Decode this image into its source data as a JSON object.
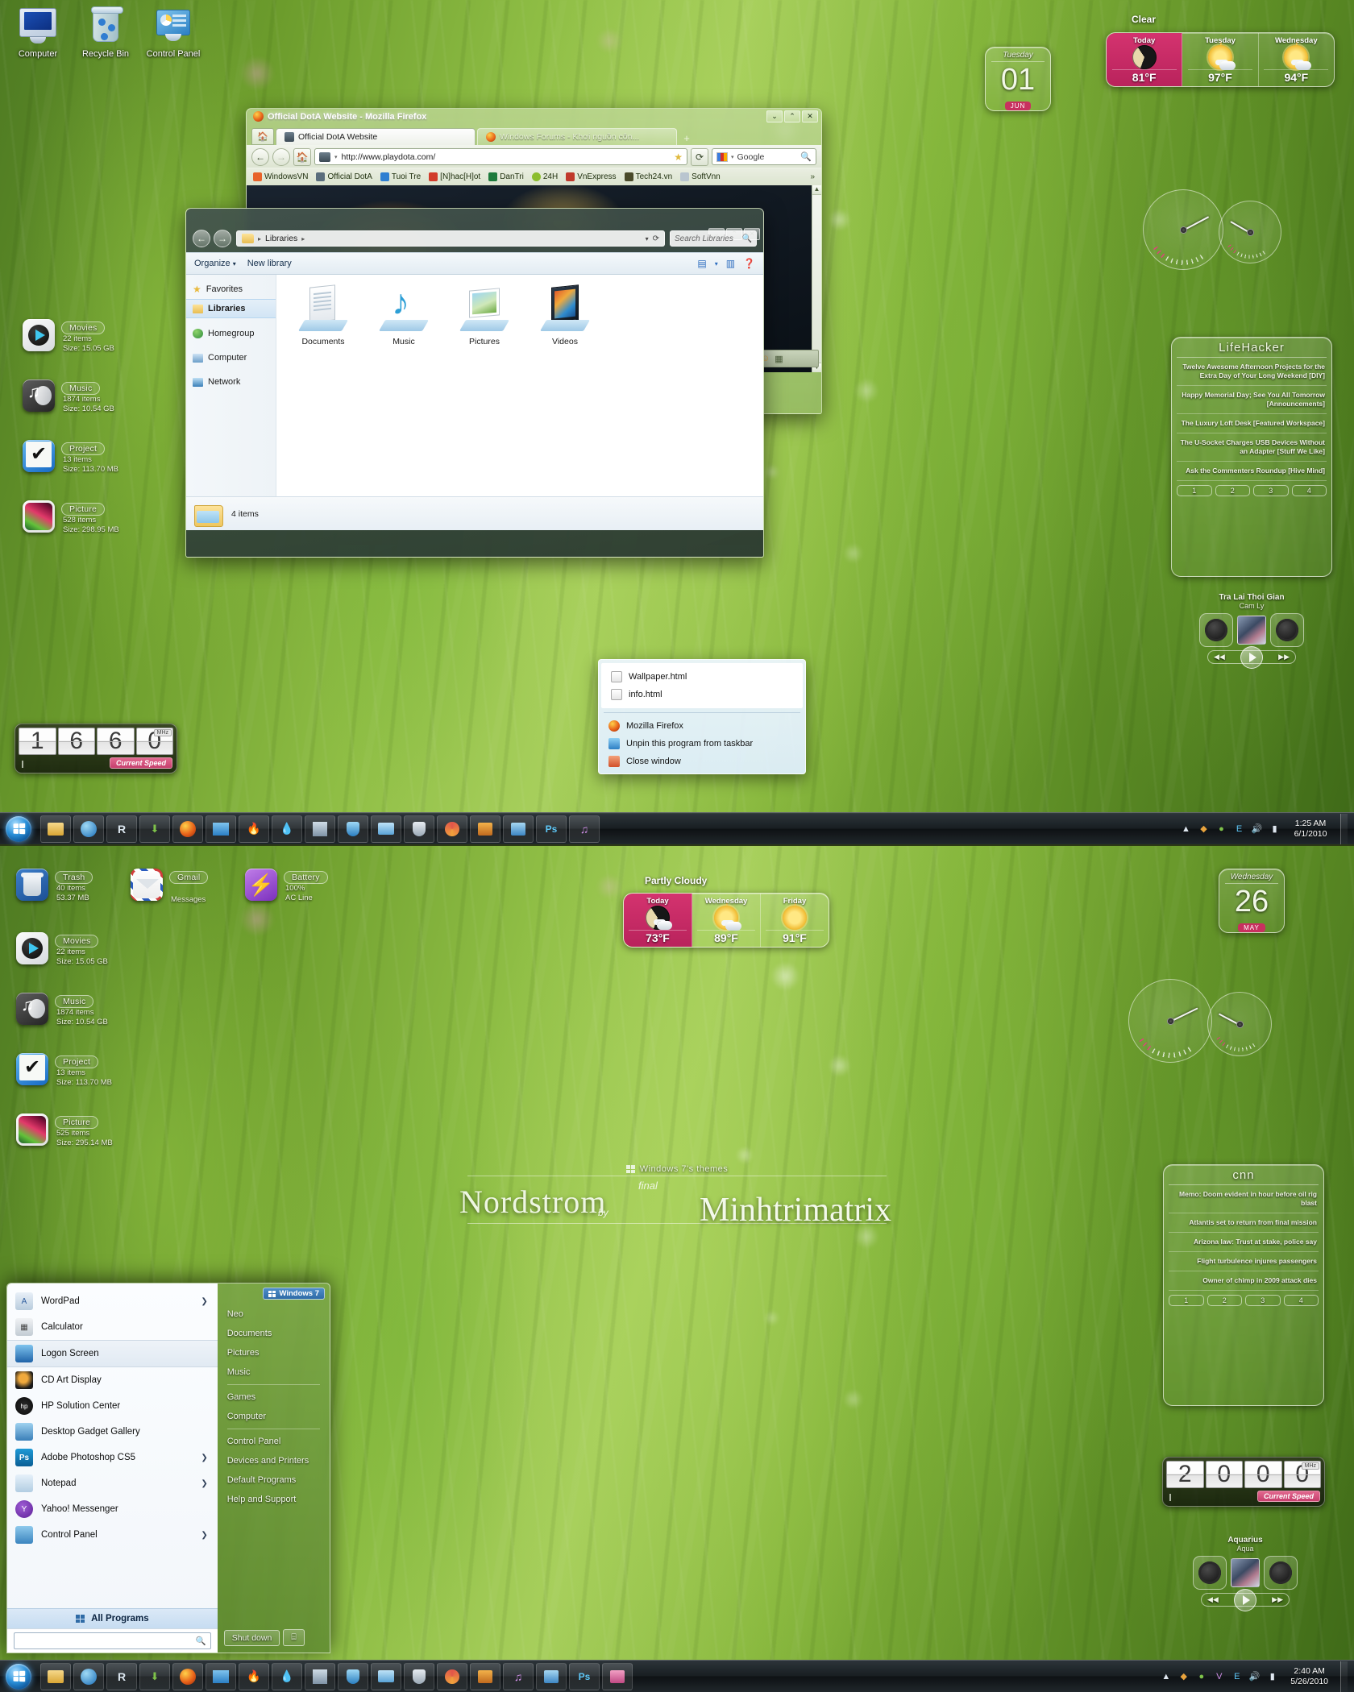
{
  "desktop_icons": [
    {
      "label": "Computer",
      "icon": "computer-icon"
    },
    {
      "label": "Recycle Bin",
      "icon": "recycle-bin-icon"
    },
    {
      "label": "Control Panel",
      "icon": "control-panel-icon"
    }
  ],
  "file_gadgets_top": [
    {
      "name": "Movies",
      "count": "22 items",
      "size": "Size: 15.05 GB",
      "icon": "movies-icon"
    },
    {
      "name": "Music",
      "count": "1874 items",
      "size": "Size: 10.54 GB",
      "icon": "music-icon"
    },
    {
      "name": "Project",
      "count": "13 items",
      "size": "Size: 113.70 MB",
      "icon": "project-icon"
    },
    {
      "name": "Picture",
      "count": "528 items",
      "size": "Size: 298.95 MB",
      "icon": "picture-icon"
    }
  ],
  "file_gadgets_bottom_row1": [
    {
      "name": "Trash",
      "count": "40 items",
      "size": "53.37 MB",
      "icon": "trash-icon"
    },
    {
      "name": "Gmail",
      "count": "",
      "size": "Messages",
      "icon": "gmail-icon"
    },
    {
      "name": "Battery",
      "count": "100%",
      "size": "AC Line",
      "icon": "battery-icon"
    }
  ],
  "file_gadgets_bottom": [
    {
      "name": "Movies",
      "count": "22 items",
      "size": "Size: 15.05 GB",
      "icon": "movies-icon"
    },
    {
      "name": "Music",
      "count": "1874 items",
      "size": "Size: 10.54 GB",
      "icon": "music-icon"
    },
    {
      "name": "Project",
      "count": "13 items",
      "size": "Size: 113.70 MB",
      "icon": "project-icon"
    },
    {
      "name": "Picture",
      "count": "525 items",
      "size": "Size: 295.14 MB",
      "icon": "picture-icon"
    }
  ],
  "calendar_top": {
    "weekday": "Tuesday",
    "day": "01",
    "month": "JUN"
  },
  "calendar_bottom": {
    "weekday": "Wednesday",
    "day": "26",
    "month": "MAY"
  },
  "weather_top": {
    "condition": "Clear",
    "days": [
      {
        "label": "Today",
        "temp": "81°F",
        "icon": "moon-icon"
      },
      {
        "label": "Tuesday",
        "temp": "97°F",
        "icon": "sun-cloud-icon"
      },
      {
        "label": "Wednesday",
        "temp": "94°F",
        "icon": "sun-cloud-icon"
      }
    ]
  },
  "weather_bottom": {
    "condition": "Partly Cloudy",
    "days": [
      {
        "label": "Today",
        "temp": "73°F",
        "icon": "moon-cloud-icon"
      },
      {
        "label": "Wednesday",
        "temp": "89°F",
        "icon": "sun-cloud-icon"
      },
      {
        "label": "Friday",
        "temp": "91°F",
        "icon": "sun-icon"
      }
    ]
  },
  "feed_lifehacker": {
    "title": "LifeHacker",
    "items": [
      "Twelve Awesome Afternoon Projects for the Extra Day of Your Long Weekend [DIY]",
      "Happy Memorial Day; See You All Tomorrow [Announcements]",
      "The Luxury Loft Desk [Featured Workspace]",
      "The U-Socket Charges USB Devices Without an Adapter [Stuff We Like]",
      "Ask the Commenters Roundup [Hive Mind]"
    ],
    "pages": [
      "1",
      "2",
      "3",
      "4"
    ]
  },
  "feed_cnn": {
    "title": "cnn",
    "items": [
      "Memo: Doom evident in hour before oil rig blast",
      "Atlantis set to return from final mission",
      "Arizona law: Trust at stake, police say",
      "Flight turbulence injures passengers",
      "Owner of chimp in 2009 attack dies"
    ],
    "pages": [
      "1",
      "2",
      "3",
      "4"
    ]
  },
  "player_top": {
    "title": "Tra Lai Thoi Gian",
    "artist": "Cam Ly",
    "prev": "◀◀",
    "next": "▶▶",
    "play": "play-icon"
  },
  "player_bottom": {
    "title": "Aquarius",
    "artist": "Aqua",
    "prev": "◀◀",
    "next": "▶▶",
    "play": "play-icon"
  },
  "cpu_top": {
    "digits": [
      "1",
      "6",
      "6",
      "0"
    ],
    "unit": "MHz",
    "label": "Current Speed"
  },
  "cpu_bottom": {
    "digits": [
      "2",
      "0",
      "0",
      "0"
    ],
    "unit": "MHz",
    "label": "Current Speed"
  },
  "firefox": {
    "window_title": "Official DotA Website - Mozilla Firefox",
    "tabs": [
      {
        "label": "Official DotA Website",
        "active": true
      },
      {
        "label": "Windows Forums - Khơi nguồn côn...",
        "active": false
      }
    ],
    "new_tab": "+",
    "url": "http://www.playdota.com/",
    "search_engine": "Google",
    "search_placeholder": "Google",
    "bookmarks": [
      {
        "label": "WindowsVN",
        "color": "#e8632a"
      },
      {
        "label": "Official DotA",
        "color": "#5a6d7c"
      },
      {
        "label": "Tuoi Tre",
        "color": "#2e7fd1"
      },
      {
        "label": "[N]hac[H]ot",
        "color": "#d23b2a"
      },
      {
        "label": "DanTri",
        "color": "#1d7a3c"
      },
      {
        "label": "24H",
        "color": "#8bbd2e"
      },
      {
        "label": "VnExpress",
        "color": "#c0392b"
      },
      {
        "label": "Tech24.vn",
        "color": "#4a4a2a"
      },
      {
        "label": "SoftVnn",
        "color": "#b9c5cf"
      }
    ],
    "bookmarks_overflow": "»",
    "window_buttons": {
      "minimize": "⌄",
      "maximize": "⌃",
      "close": "✕"
    }
  },
  "explorer": {
    "breadcrumb": "Libraries",
    "search_placeholder": "Search Libraries",
    "toolbar": [
      "Organize",
      "New library"
    ],
    "nav_items": [
      "Favorites",
      "Libraries",
      "Homegroup",
      "Computer",
      "Network"
    ],
    "nav_selected": "Libraries",
    "libraries": [
      {
        "label": "Documents"
      },
      {
        "label": "Music"
      },
      {
        "label": "Pictures"
      },
      {
        "label": "Videos"
      }
    ],
    "status": "4 items",
    "window_buttons": {
      "minimize": "⌄",
      "maximize": "⌃",
      "close": "✕"
    }
  },
  "jumplist": {
    "recent": [
      {
        "label": "Wallpaper.html",
        "icon": "html-file-icon"
      },
      {
        "label": "info.html",
        "icon": "html-file-icon"
      }
    ],
    "actions": [
      {
        "label": "Mozilla Firefox",
        "icon": "firefox-icon"
      },
      {
        "label": "Unpin this program from taskbar",
        "icon": "unpin-icon"
      },
      {
        "label": "Close window",
        "icon": "close-window-icon"
      }
    ]
  },
  "start_menu": {
    "programs": [
      {
        "label": "WordPad",
        "arrow": true,
        "color": "#e8eef6"
      },
      {
        "label": "Calculator",
        "arrow": false,
        "color": "#dde6ee"
      },
      {
        "label": "Logon Screen",
        "arrow": false,
        "color": "#2c73b8",
        "highlight": true
      },
      {
        "label": "CD Art Display",
        "arrow": false,
        "color": "#17181c"
      },
      {
        "label": "HP Solution Center",
        "arrow": false,
        "color": "#1f1f1f"
      },
      {
        "label": "Desktop Gadget Gallery",
        "arrow": false,
        "color": "#4a90c9"
      },
      {
        "label": "Adobe Photoshop CS5",
        "arrow": true,
        "color": "#0d7ec4"
      },
      {
        "label": "Notepad",
        "arrow": true,
        "color": "#cfe3f2"
      },
      {
        "label": "Yahoo! Messenger",
        "arrow": false,
        "color": "#6b2fa0"
      },
      {
        "label": "Control Panel",
        "arrow": true,
        "color": "#5ba3d9"
      }
    ],
    "all_programs": "All Programs",
    "search_placeholder": "",
    "search_icon": "search-icon",
    "user_tag": "Windows 7",
    "right_items": [
      "Neo",
      "Documents",
      "Pictures",
      "Music",
      "Games",
      "Computer",
      "Control Panel",
      "Devices and Printers",
      "Default Programs",
      "Help and Support"
    ],
    "shutdown": "Shut down",
    "shutdown_arrow": "⌸"
  },
  "taskbar_top": {
    "start": "start-orb",
    "buttons": [
      "explorer-icon",
      "media-player-icon",
      "r-app-icon",
      "downloads-icon",
      "firefox-icon",
      "photo-app-icon",
      "flame-app-icon",
      "droplet-icon",
      "paint-icon",
      "shield-app-icon",
      "folder-icon",
      "security-icon",
      "burn-icon",
      "orange-app-icon",
      "blue-app-icon",
      "photoshop-icon",
      "music-icon"
    ],
    "tray": [
      "arrow-up-icon",
      "antivirus-icon",
      "network-shield-icon",
      "e-icon",
      "volume-icon",
      "network-icon"
    ],
    "clock_time": "1:25 AM",
    "clock_date": "6/1/2010"
  },
  "taskbar_bottom": {
    "start": "start-orb",
    "buttons": [
      "explorer-icon",
      "media-player-icon",
      "r-app-icon",
      "downloads-icon",
      "firefox-icon",
      "photo-app-icon",
      "flame-app-icon",
      "droplet-icon",
      "paint-icon",
      "shield-app-icon",
      "folder-icon",
      "security-icon",
      "burn-icon",
      "orange-app-icon",
      "music-icon",
      "blue-app-icon",
      "photoshop-icon",
      "pink-app-icon"
    ],
    "tray": [
      "arrow-up-icon",
      "antivirus-icon",
      "network-shield-icon",
      "v-icon",
      "e-icon",
      "volume-icon",
      "network-icon"
    ],
    "clock_time": "2:40 AM",
    "clock_date": "5/26/2010"
  },
  "watermark": {
    "top_line": "Windows 7's themes",
    "name_a": "Nordstrom",
    "name_b": "Minhtrimatrix",
    "sub_a": "final",
    "sub_b": "by"
  },
  "colors": {
    "accent_pink": "#c8305f",
    "aero_glass": "rgba(190,215,150,0.8)",
    "taskbar": "#1a1f26"
  }
}
